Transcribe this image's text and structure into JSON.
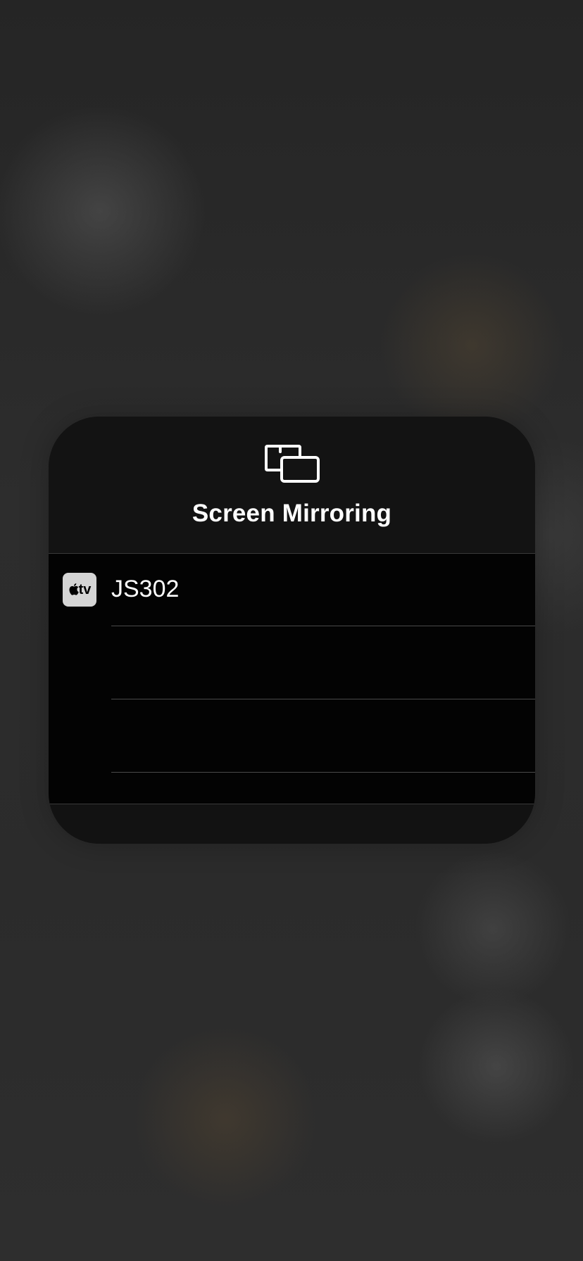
{
  "screen": {
    "title": "Screen Mirroring",
    "header_icon": "screen-mirroring-icon"
  },
  "devices": [
    {
      "name": "JS302",
      "icon": "apple-tv-icon",
      "icon_label": "tv"
    }
  ],
  "colors": {
    "panel_background": "#121212",
    "list_background": "#030303",
    "text": "#ffffff",
    "device_icon_background": "#d5d5d5"
  }
}
